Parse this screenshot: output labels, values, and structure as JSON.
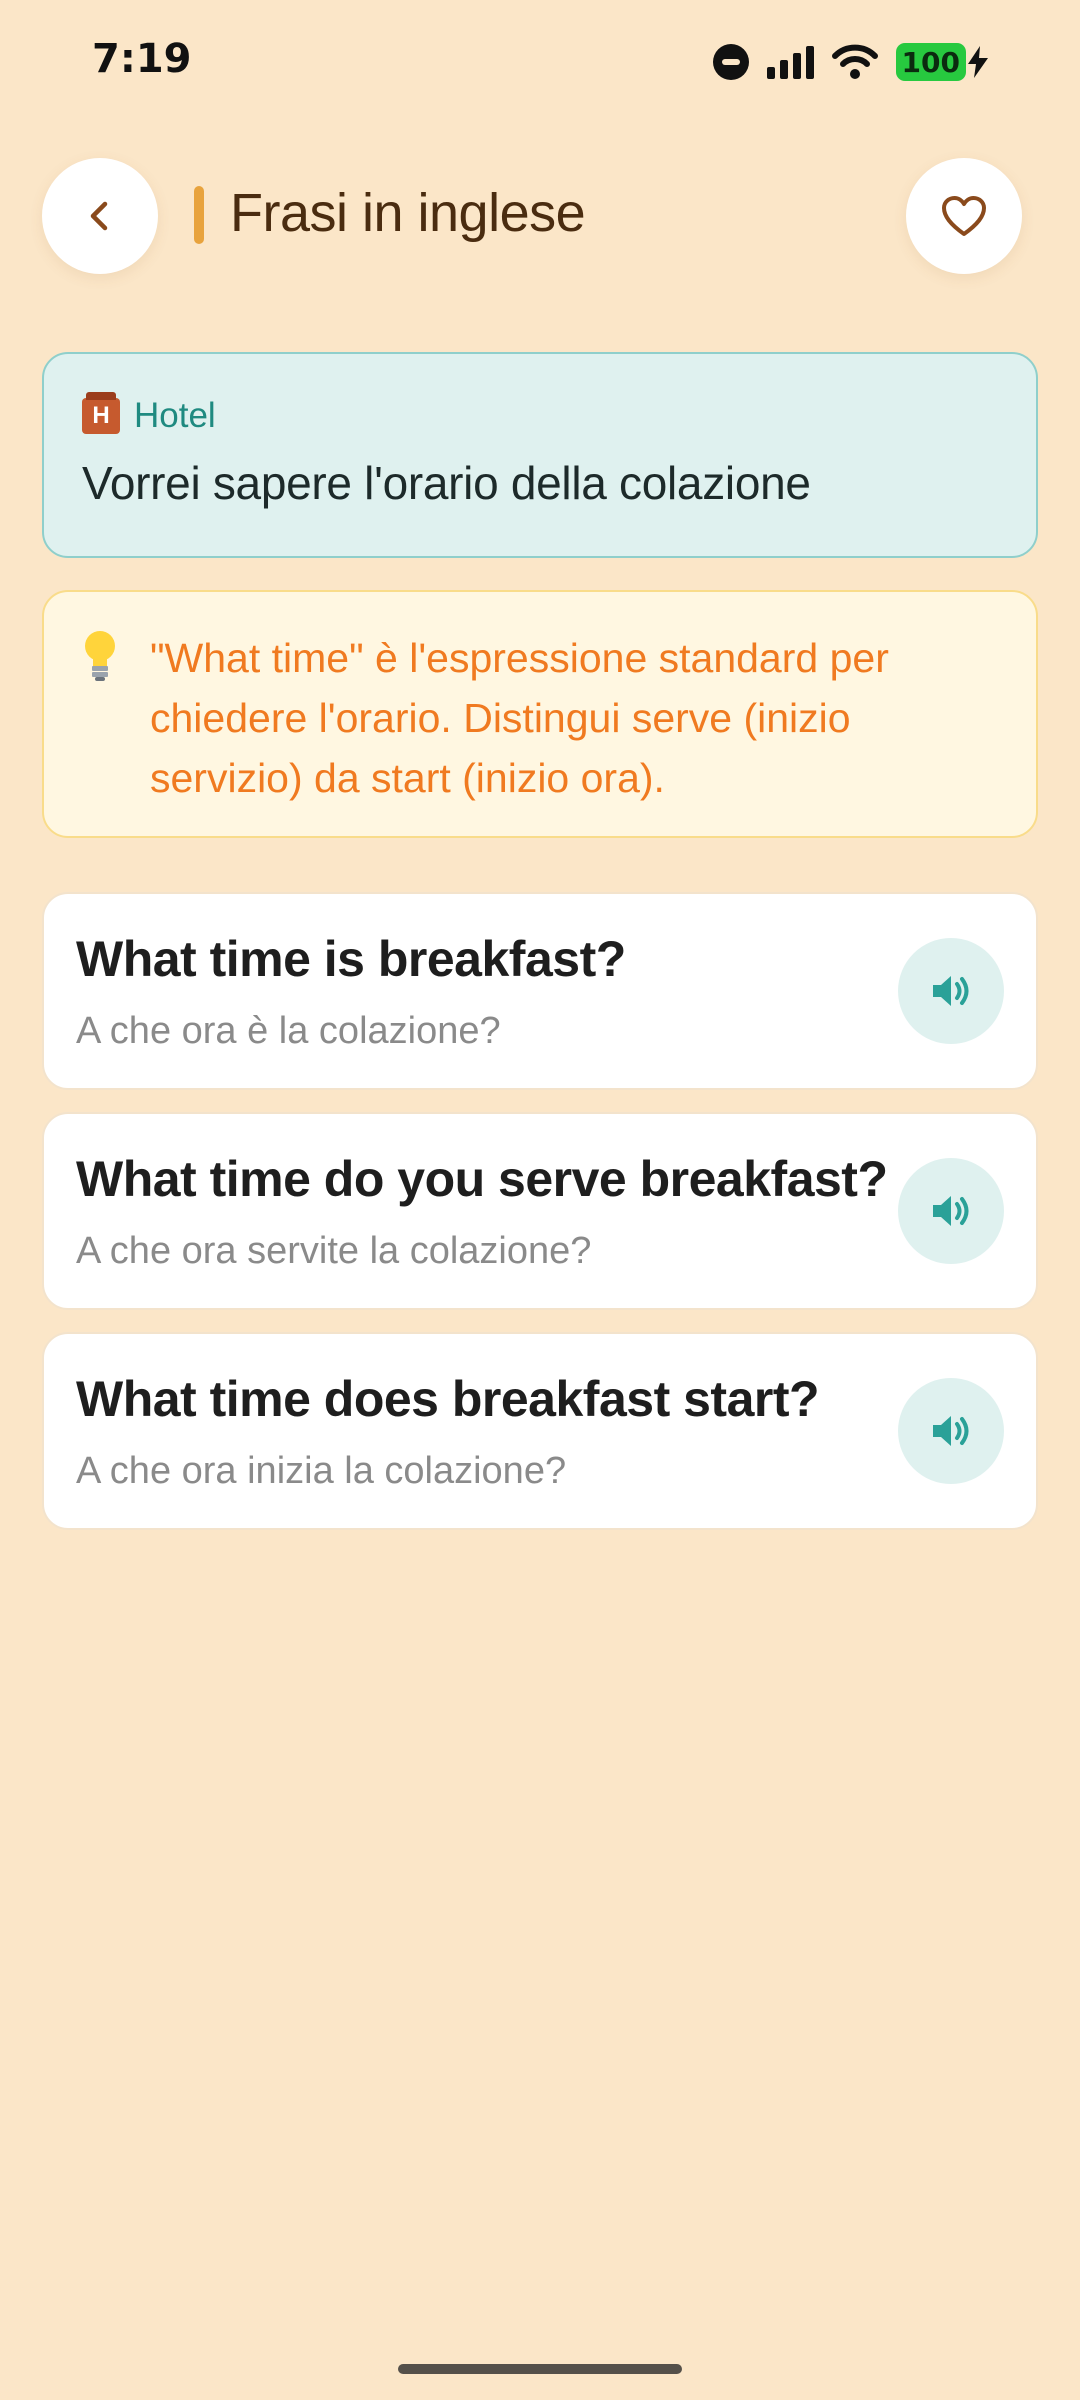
{
  "status_bar": {
    "time": "7:19",
    "battery_level": "100",
    "icons": [
      "do-not-disturb-icon",
      "signal-icon",
      "wifi-icon",
      "battery-icon",
      "charging-bolt-icon"
    ]
  },
  "header": {
    "back_icon": "chevron-left-icon",
    "title": "Frasi in inglese",
    "favorite_icon": "heart-outline-icon"
  },
  "context": {
    "icon": "hotel-icon",
    "category": "Hotel",
    "sentence": "Vorrei sapere l'orario della colazione"
  },
  "tip": {
    "icon": "light-bulb-icon",
    "text": "\"What time\" è l'espressione standard per chiedere l'orario. Distingui serve (inizio servizio) da start (inizio ora)."
  },
  "phrases": [
    {
      "english": "What time is breakfast?",
      "italian": "A che ora è la colazione?",
      "icon": "speaker-icon"
    },
    {
      "english": "What time do you serve breakfast?",
      "italian": "A che ora servite la colazione?",
      "icon": "speaker-icon"
    },
    {
      "english": "What time does breakfast start?",
      "italian": "A che ora inizia la colazione?",
      "icon": "speaker-icon"
    }
  ],
  "colors": {
    "background": "#fbe6c8",
    "accent_orange": "#e8a33d",
    "title_brown": "#4a2c10",
    "teal": "#1f8a80",
    "tip_orange": "#f07a20",
    "battery_green": "#27c93f"
  }
}
